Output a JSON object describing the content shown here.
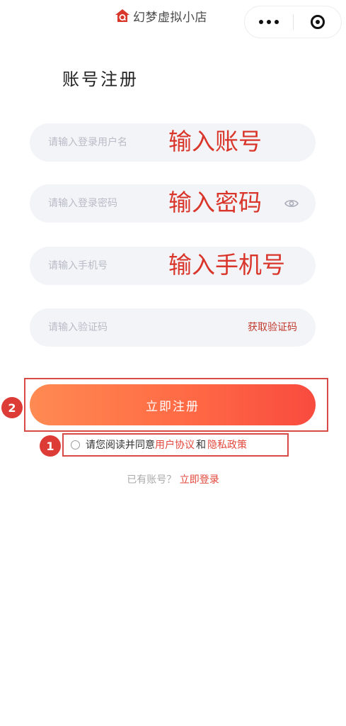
{
  "app": {
    "name": "幻梦虚拟小店",
    "logo_icon": "house-logo-icon",
    "accent_color": "#e2463a"
  },
  "capsule": {
    "more_icon": "more-dots-icon",
    "close_icon": "target-close-icon"
  },
  "page": {
    "title": "账号注册"
  },
  "form": {
    "username": {
      "placeholder": "请输入登录用户名",
      "annotation": "输入账号"
    },
    "password": {
      "placeholder": "请输入登录密码",
      "annotation": "输入密码",
      "toggle_icon": "eye-icon"
    },
    "phone": {
      "placeholder": "请输入手机号",
      "annotation": "输入手机号"
    },
    "code": {
      "placeholder": "请输入验证码",
      "get_code_label": "获取验证码"
    },
    "submit_label": "立即注册"
  },
  "agreement": {
    "prefix": "请您阅读并同意",
    "user_agreement": "用户协议",
    "and": "和",
    "privacy_policy": "隐私政策"
  },
  "login": {
    "question": "已有账号？",
    "link": "立即登录"
  },
  "markers": {
    "step_1": "1",
    "step_2": "2"
  }
}
